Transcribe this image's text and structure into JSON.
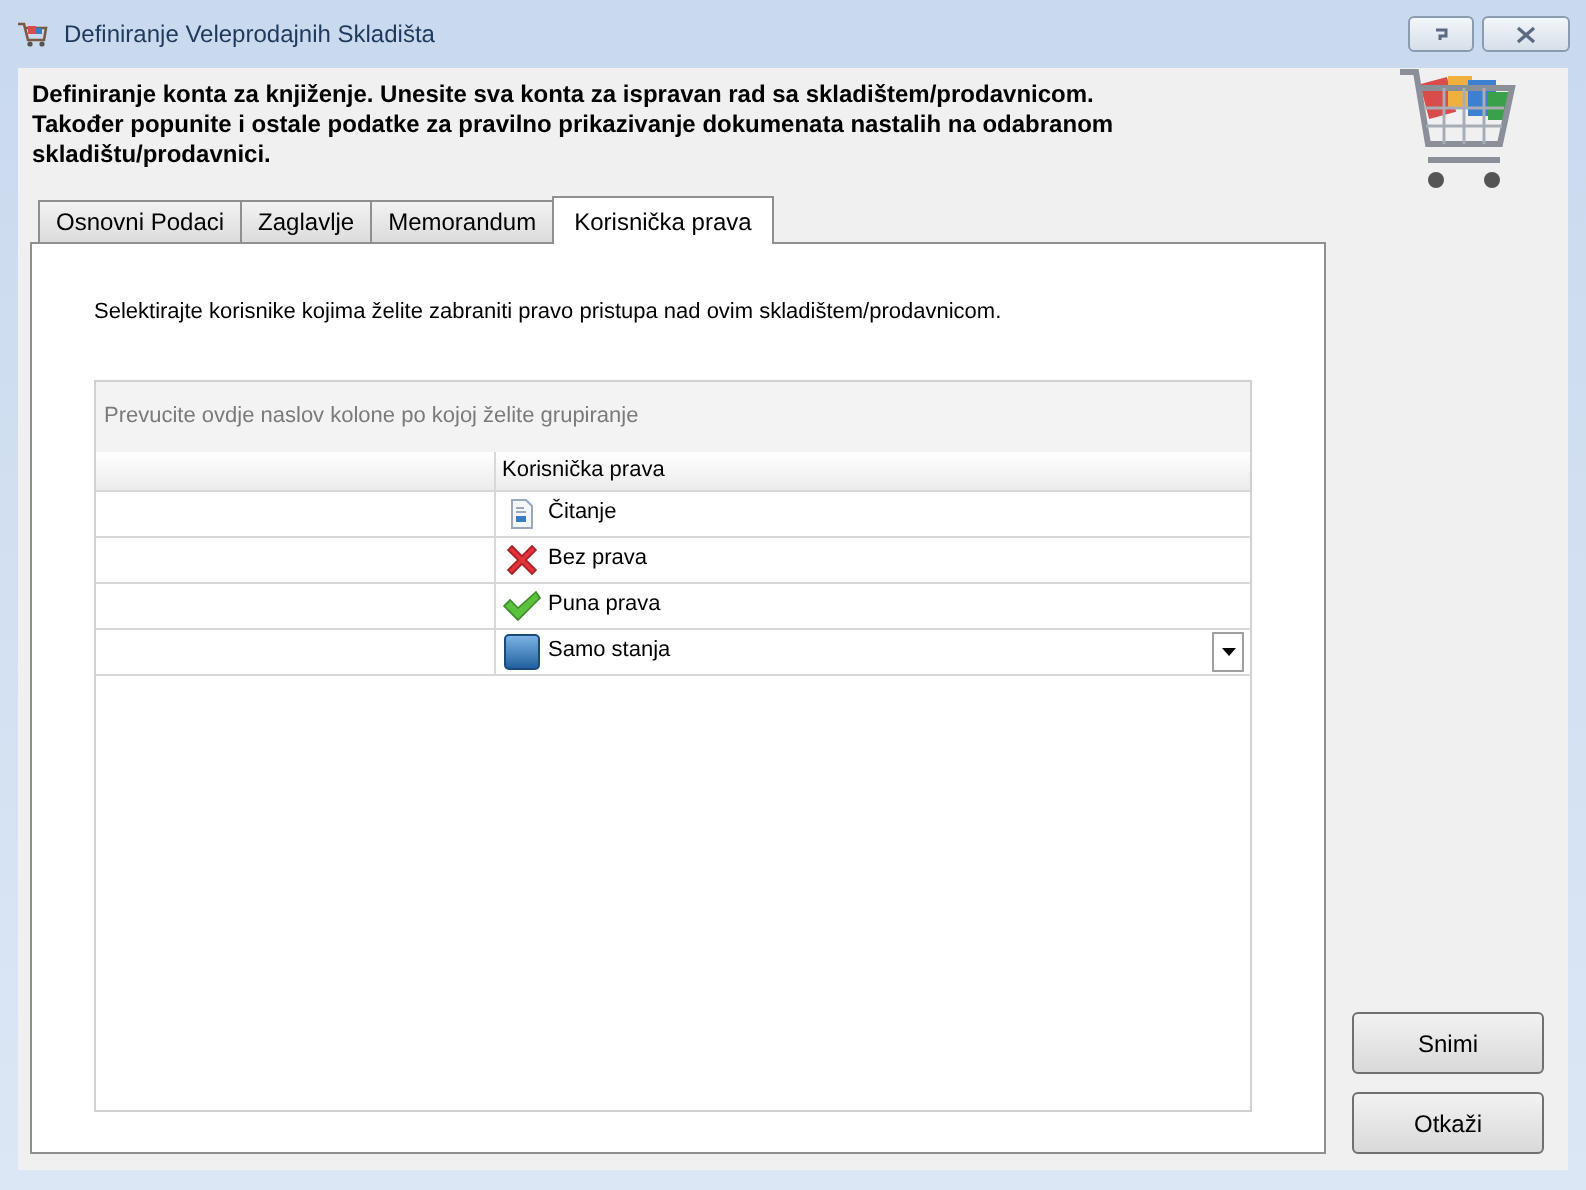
{
  "window": {
    "title": "Definiranje Veleprodajnih Skladišta"
  },
  "header": {
    "lines": [
      "Definiranje konta za knjiženje. Unesite sva konta za ispravan rad sa skladištem/prodavnicom.",
      "Također popunite i ostale podatke za pravilno prikazivanje dokumenata nastalih na odabranom skladištu/prodavnici."
    ]
  },
  "tabs": [
    {
      "label": "Osnovni Podaci",
      "selected": false
    },
    {
      "label": "Zaglavlje",
      "selected": false
    },
    {
      "label": "Memorandum",
      "selected": false
    },
    {
      "label": "Korisnička prava",
      "selected": true
    }
  ],
  "instruction": "Selektirajte korisnike kojima želite zabraniti pravo pristupa nad ovim skladištem/prodavnicom.",
  "grid": {
    "group_hint": "Prevucite ovdje naslov kolone po kojoj želite grupiranje",
    "columns": [
      "Korisnička prava"
    ],
    "rows": [
      {
        "kind": "read",
        "value": "Čitanje",
        "editing": false
      },
      {
        "kind": "none",
        "value": "Bez prava",
        "editing": false
      },
      {
        "kind": "full",
        "value": "Puna prava",
        "editing": false
      },
      {
        "kind": "stock",
        "value": "Samo stanja",
        "editing": true
      }
    ]
  },
  "buttons": [
    "Snimi",
    "Otkaži"
  ]
}
